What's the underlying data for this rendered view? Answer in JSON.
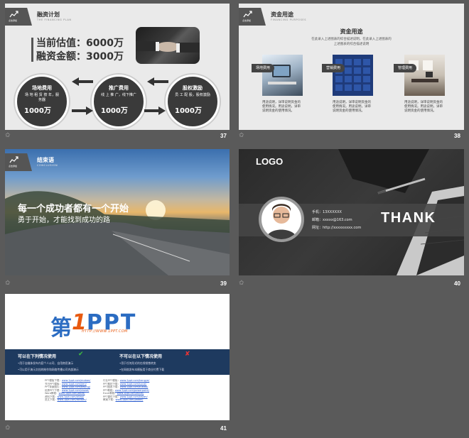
{
  "slides": [
    {
      "number": "37",
      "header": {
        "label": "点击添加",
        "title": "融资计划",
        "subtitle": "THE FINANCING PLAN"
      },
      "valuation": "当前估值：6000万",
      "amount": "融资金额：3000万",
      "circles": [
        {
          "title": "场地费用",
          "desc": "场 地 租 赁 按 年，服务器",
          "value": "1000万"
        },
        {
          "title": "推广费用",
          "desc": "线 上 推 广，线下推广",
          "value": "1000万"
        },
        {
          "title": "股权激励",
          "desc": "员 工 配 股，股权激励",
          "value": "1000万"
        }
      ]
    },
    {
      "number": "38",
      "header": {
        "label": "点击添加",
        "title": "资金用途",
        "subtitle": "FINANCING PURPOSES"
      },
      "heading": "资金用途",
      "lines": [
        "在此录入上述图表的综合描述说明，在此录入上述图表的",
        "上述图表的综合描述说明"
      ],
      "cards": [
        {
          "tag": "场地费用",
          "text": "用途说明，详审说明资金的使用情况。用途说明，详审说明资金的使用情况。"
        },
        {
          "tag": "营销费用",
          "text": "用途说明，详审说明资金的使用情况。用途说明，详审说明资金的使用情况。"
        },
        {
          "tag": "管理费用",
          "text": "用途说明，详审说明资金的使用情况。用途说明，详审说明资金的使用情况。"
        }
      ]
    },
    {
      "number": "39",
      "header": {
        "label": "点击添加",
        "title": "结束语",
        "subtitle": "CONCLUSION"
      },
      "line1": "每一个成功者都有一个开始",
      "line2": "勇于开始，才能找到成功的路"
    },
    {
      "number": "40",
      "logo": "LOGO",
      "thank": "THANK",
      "contacts": [
        "手机：13XXXXXX",
        "邮箱：xxxxx@163.com",
        "网址：http://xxxxxxxxx.com"
      ]
    },
    {
      "number": "41",
      "logo_left": "第",
      "logo_one": "1",
      "logo_right": "PPT",
      "logo_url": "HTTP://WWW.1PPT.COM",
      "ok_title": "可以在下列情况使用",
      "ok_lines": [
        "•用于自媒体发布内容个人公司、自用商用演示",
        "•可以用于演示文档的制作和网络传播公司内部演示"
      ],
      "no_title": "不可以在以下情况使用",
      "no_lines": [
        "•用于任何形式的在线销售转卖",
        "•在网络发布本模板用于商业付费下载"
      ],
      "links_a": [
        {
          "k": "PPT模板下载：",
          "u": "www.1ppt.com/moban/"
        },
        {
          "k": "节日PPT模板：",
          "u": "www.1ppt.com/jieri/"
        },
        {
          "k": "PPT背景图片：",
          "u": "www.1ppt.com/beijing/"
        },
        {
          "k": "优秀PPT下载：",
          "u": "www.1ppt.com/xiazai/"
        },
        {
          "k": "Word教程：",
          "u": "www.1ppt.com/word/"
        },
        {
          "k": "资料下载：",
          "u": "www.1ppt.com/ziliao/"
        },
        {
          "k": "范文下载：",
          "u": "www.1ppt.com/fanwen/"
        }
      ],
      "links_b": [
        {
          "k": "行业PPT模板：",
          "u": "www.1ppt.com/hangye/"
        },
        {
          "k": "PPT素材下载：",
          "u": "www.1ppt.com/sucai/"
        },
        {
          "k": "PPT图表下载：",
          "u": "www.1ppt.com/tubiao/"
        },
        {
          "k": "PPT教程：",
          "u": "www.1ppt.com/powerpoint/"
        },
        {
          "k": "Excel教程：",
          "u": "www.1ppt.com/excel/"
        },
        {
          "k": "PPT课件下载：",
          "u": "www.1ppt.com/kejian/"
        },
        {
          "k": "教案下载：",
          "u": "www.1ppt.com/jiaoan/"
        }
      ]
    }
  ]
}
